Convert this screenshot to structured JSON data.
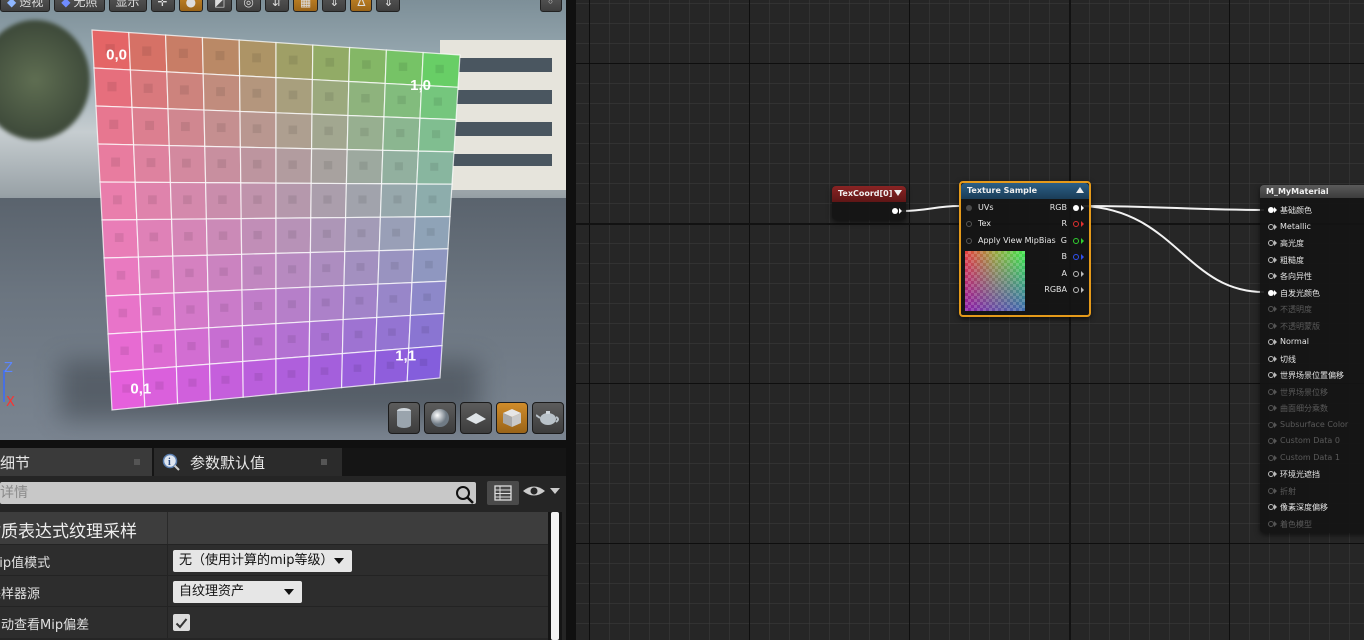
{
  "viewport": {
    "toolbar": {
      "perspective_label": "透视",
      "lit_label": "无照",
      "show_label": "显示"
    },
    "uv_labels": [
      "0,0",
      "1,0",
      "0,1",
      "1,1"
    ],
    "axis_z": "Z",
    "axis_x": "X",
    "preview_shapes": [
      "cylinder-icon",
      "sphere-icon",
      "plane-icon",
      "cube-icon",
      "teapot-icon"
    ]
  },
  "details": {
    "tabs": [
      {
        "label": "细节",
        "active": true
      },
      {
        "label": "参数默认值",
        "active": false
      }
    ],
    "search_placeholder": "搜索详情",
    "category_title": "材质表达式纹理采样",
    "properties": [
      {
        "label": "Mip值模式",
        "value": "无（使用计算的mip等级）"
      },
      {
        "label": "采样器源",
        "value": "自纹理资产"
      },
      {
        "label": "自动查看Mip偏差",
        "checked": true
      }
    ]
  },
  "graph": {
    "texcoord_node": {
      "title": "TexCoord[0]"
    },
    "texture_sample_node": {
      "title": "Texture Sample",
      "inputs": [
        "UVs",
        "Tex",
        "Apply View MipBias"
      ],
      "outputs": [
        {
          "label": "RGB",
          "color": "#ffffff"
        },
        {
          "label": "R",
          "color": "#e03030"
        },
        {
          "label": "G",
          "color": "#30d030"
        },
        {
          "label": "B",
          "color": "#3050f0"
        },
        {
          "label": "A",
          "color": "#cccccc"
        },
        {
          "label": "RGBA",
          "color": "#cccccc"
        }
      ]
    },
    "material_node": {
      "title": "M_MyMaterial",
      "inputs": [
        {
          "label": "基础颜色",
          "enabled": true,
          "connected": true
        },
        {
          "label": "Metallic",
          "enabled": true
        },
        {
          "label": "高光度",
          "enabled": true
        },
        {
          "label": "粗糙度",
          "enabled": true
        },
        {
          "label": "各向异性",
          "enabled": true
        },
        {
          "label": "自发光颜色",
          "enabled": true,
          "connected": true
        },
        {
          "label": "不透明度",
          "enabled": false
        },
        {
          "label": "不透明蒙版",
          "enabled": false
        },
        {
          "label": "Normal",
          "enabled": true
        },
        {
          "label": "切线",
          "enabled": true
        },
        {
          "label": "世界场景位置偏移",
          "enabled": true
        },
        {
          "label": "世界场景位移",
          "enabled": false
        },
        {
          "label": "曲面细分乘数",
          "enabled": false
        },
        {
          "label": "Subsurface Color",
          "enabled": false
        },
        {
          "label": "Custom Data 0",
          "enabled": false
        },
        {
          "label": "Custom Data 1",
          "enabled": false
        },
        {
          "label": "环境光遮挡",
          "enabled": true
        },
        {
          "label": "折射",
          "enabled": false
        },
        {
          "label": "像素深度偏移",
          "enabled": true
        },
        {
          "label": "着色模型",
          "enabled": false
        }
      ]
    }
  }
}
